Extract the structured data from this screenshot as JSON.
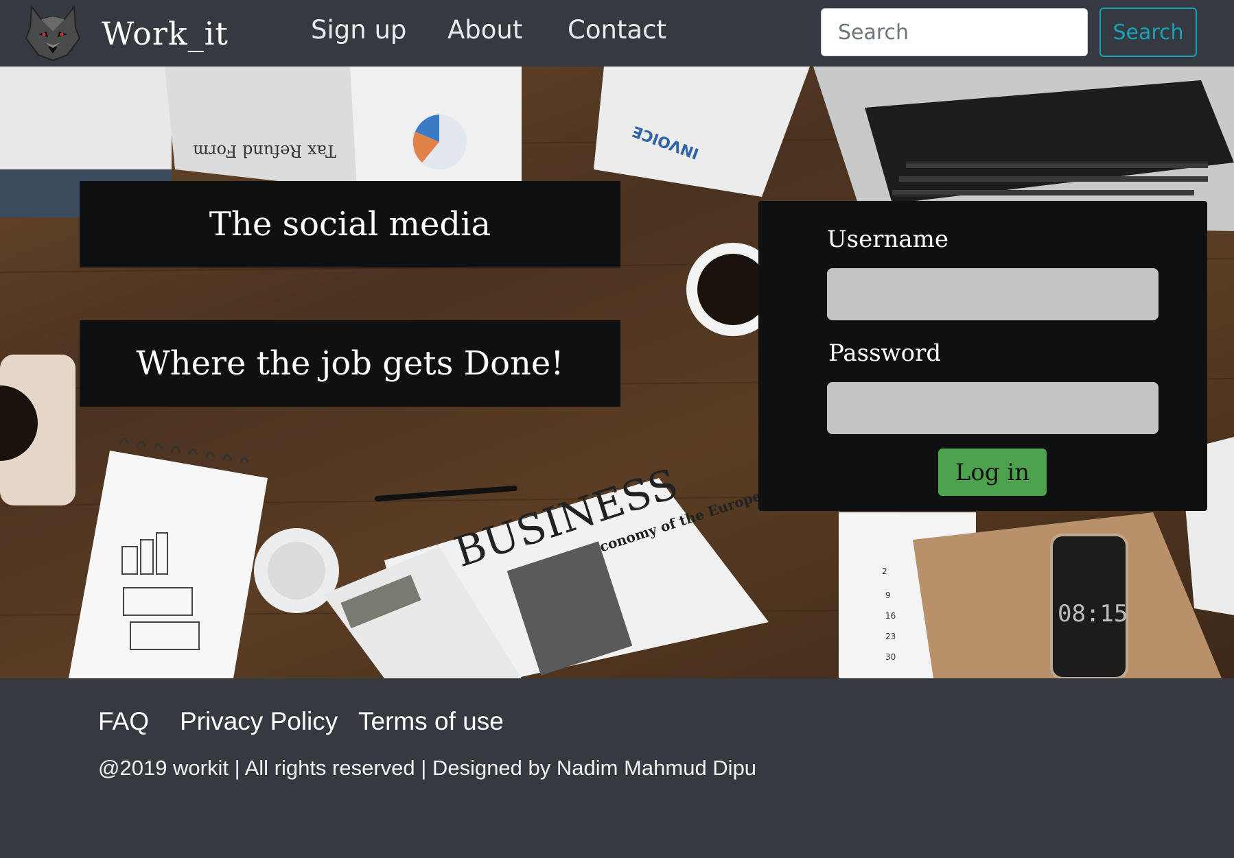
{
  "navbar": {
    "brand": "Work_it",
    "links": [
      "Sign up",
      "About",
      "Contact"
    ],
    "search_placeholder": "Search",
    "search_button": "Search"
  },
  "hero": {
    "banner_1": "The social media",
    "banner_2": "Where the job gets Done!",
    "phone_time": "08:15",
    "newspaper_heading": "BUSINESS",
    "newspaper_subheading": "Economy of the European Union",
    "document_label": "INVOICE",
    "tax_form_label": "Tax Refund Form"
  },
  "login": {
    "username_label": "Username",
    "password_label": "Password",
    "username_value": "",
    "password_value": "",
    "button_label": "Log in"
  },
  "footer": {
    "links": [
      "FAQ",
      "Privacy Policy",
      "Terms of use"
    ],
    "copyright": "@2019 workit | All rights reserved | Designed by Nadim Mahmud Dipu"
  },
  "colors": {
    "navbar_bg": "#343a40",
    "search_accent": "#17a2b8",
    "login_button": "#4da24d",
    "panel_bg": "#0e1012",
    "input_bg": "#c4c4c4"
  }
}
